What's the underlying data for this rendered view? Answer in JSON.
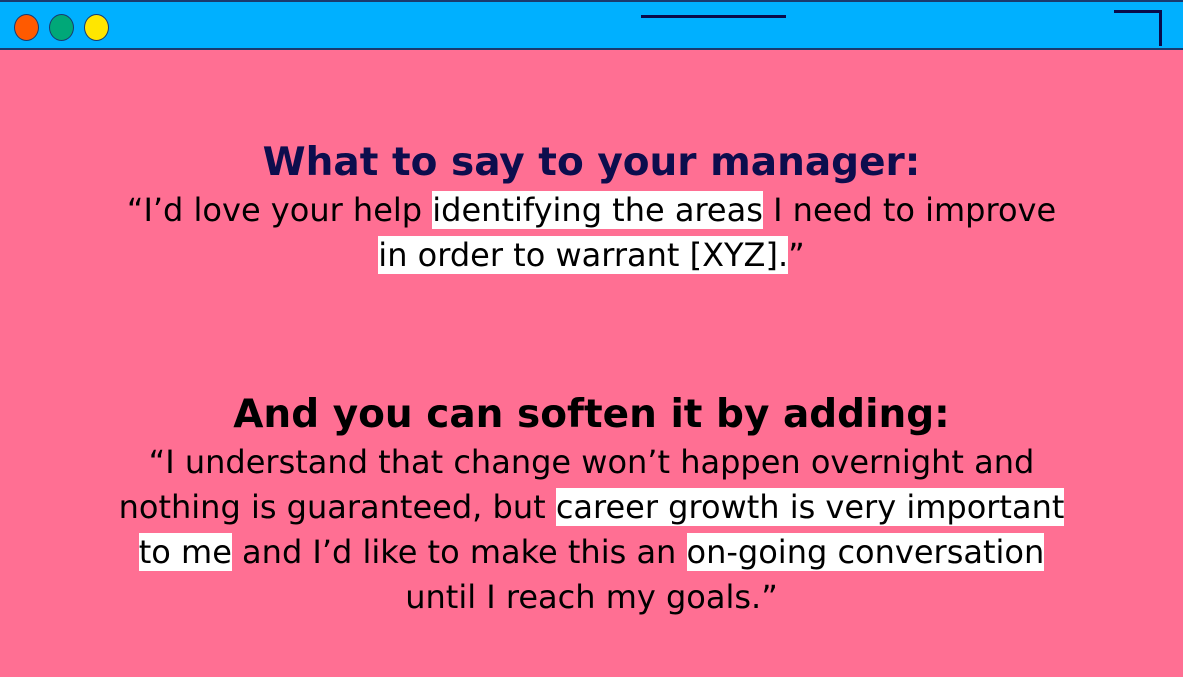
{
  "window": {
    "colors": {
      "titlebar": "#00b0ff",
      "background": "#ff6f93",
      "close": "#ff5a00",
      "minimize": "#00a878",
      "maximize": "#ffe600",
      "heading1": "#0d0d4d",
      "highlight": "#ffffff"
    }
  },
  "section1": {
    "heading": "What to say to your manager:",
    "lines": [
      [
        {
          "t": "“I’d love your help ",
          "hl": false
        },
        {
          "t": "identifying the areas",
          "hl": true
        },
        {
          "t": " I need to improve",
          "hl": false
        }
      ],
      [
        {
          "t": "in order to warrant [XYZ].",
          "hl": true
        },
        {
          "t": "”",
          "hl": false
        }
      ]
    ]
  },
  "section2": {
    "heading": "And you can soften it by adding:",
    "lines": [
      [
        {
          "t": "“I understand that change won’t happen overnight and",
          "hl": false
        }
      ],
      [
        {
          "t": "nothing is guaranteed, but ",
          "hl": false
        },
        {
          "t": "career growth is very important",
          "hl": true
        }
      ],
      [
        {
          "t": "to me",
          "hl": true
        },
        {
          "t": " and I’d like to make this an ",
          "hl": false
        },
        {
          "t": "on-going conversation",
          "hl": true
        }
      ],
      [
        {
          "t": "until I reach my goals.”",
          "hl": false
        }
      ]
    ]
  }
}
